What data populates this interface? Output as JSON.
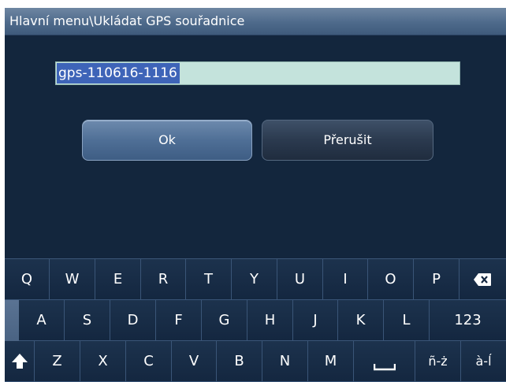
{
  "window": {
    "title": "Hlavní menu\\Ukládat GPS souřadnice"
  },
  "name_field": {
    "value": "gps-110616-1116"
  },
  "buttons": {
    "ok": "Ok",
    "cancel": "Přerušit"
  },
  "keyboard": {
    "row1": [
      "Q",
      "W",
      "E",
      "R",
      "T",
      "Y",
      "U",
      "I",
      "O",
      "P"
    ],
    "row2": [
      "A",
      "S",
      "D",
      "F",
      "G",
      "H",
      "J",
      "K",
      "L"
    ],
    "row3": [
      "Z",
      "X",
      "C",
      "V",
      "B",
      "N",
      "M"
    ],
    "numbers_label": "123",
    "accent_labels": [
      "ñ-ż",
      "à-ĺ"
    ],
    "icons": {
      "backspace": "backspace-icon",
      "shift": "shift-icon",
      "space": "space-icon"
    }
  }
}
